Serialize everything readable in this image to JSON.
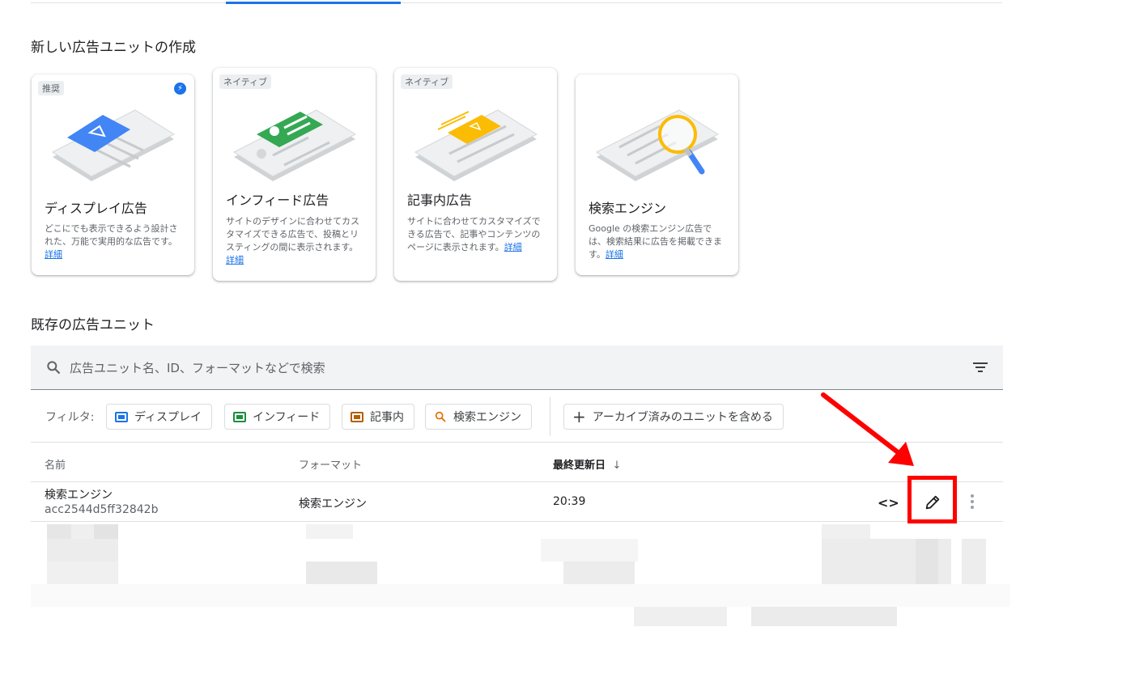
{
  "create_section": {
    "title": "新しい広告ユニットの作成"
  },
  "cards": [
    {
      "chip": "推奨",
      "title": "ディスプレイ広告",
      "desc": "どこにでも表示できるよう設計された、万能で実用的な広告です。",
      "link": "詳細"
    },
    {
      "chip": "ネイティブ",
      "title": "インフィード広告",
      "desc": "サイトのデザインに合わせてカスタマイズできる広告で、投稿とリスティングの間に表示されます。",
      "link": "詳細"
    },
    {
      "chip": "ネイティブ",
      "title": "記事内広告",
      "desc": "サイトに合わせてカスタマイズできる広告で、記事やコンテンツのページに表示されます。",
      "link": "詳細"
    },
    {
      "chip": "",
      "title": "検索エンジン",
      "desc": "Google の検索エンジン広告では、検索結果に広告を掲載できます。",
      "link": "詳細"
    }
  ],
  "existing_section": {
    "title": "既存の広告ユニット"
  },
  "search": {
    "placeholder": "広告ユニット名、ID、フォーマットなどで検索"
  },
  "filters": {
    "label": "フィルタ:",
    "chips": [
      {
        "label": "ディスプレイ",
        "color": "#1a73e8"
      },
      {
        "label": "インフィード",
        "color": "#1e8e3e"
      },
      {
        "label": "記事内",
        "color": "#b06000"
      },
      {
        "label": "検索エンジン",
        "color": "#e37400"
      }
    ],
    "archive_label": "アーカイブ済みのユニットを含める"
  },
  "table": {
    "headers": {
      "name": "名前",
      "format": "フォーマット",
      "updated": "最終更新日"
    },
    "rows": [
      {
        "name": "検索エンジン",
        "id": "acc2544d5ff32842b",
        "format": "検索エンジン",
        "updated": "20:39"
      }
    ]
  },
  "colors": {
    "accent": "#1a73e8",
    "highlight": "#ff0000"
  }
}
